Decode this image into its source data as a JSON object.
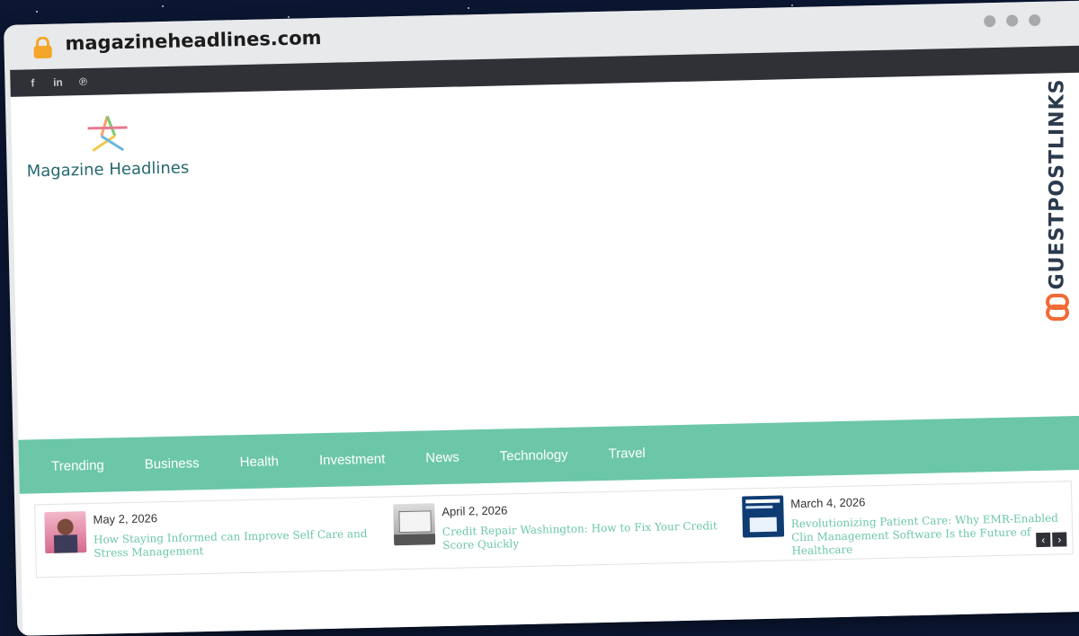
{
  "browser": {
    "url": "magazineheadlines.com",
    "lock_icon": "lock-icon"
  },
  "topbar": {
    "social": [
      {
        "icon": "facebook-icon",
        "glyph": "f"
      },
      {
        "icon": "linkedin-icon",
        "glyph": "in"
      },
      {
        "icon": "pinterest-icon",
        "glyph": "℗"
      }
    ]
  },
  "logo": {
    "text": "Magazine Headlines"
  },
  "nav": {
    "items": [
      "Trending",
      "Business",
      "Health",
      "Investment",
      "News",
      "Technology",
      "Travel"
    ]
  },
  "ticker": {
    "items": [
      {
        "date": "May 2, 2026",
        "title": "How Staying Informed can Improve Self Care and Stress Management"
      },
      {
        "date": "April 2, 2026",
        "title": "Credit Repair Washington: How to Fix Your Credit Score Quickly"
      },
      {
        "date": "March 4, 2026",
        "title": "Revolutionizing Patient Care: Why EMR-Enabled Clin Management Software Is the Future of Healthcare"
      }
    ],
    "prev": "‹",
    "next": "›"
  },
  "badge": {
    "text": "GUESTPOSTLINKS"
  },
  "colors": {
    "accent": "#6cc7a8",
    "topbar": "#2f3136",
    "badge_orange": "#f26a35"
  }
}
